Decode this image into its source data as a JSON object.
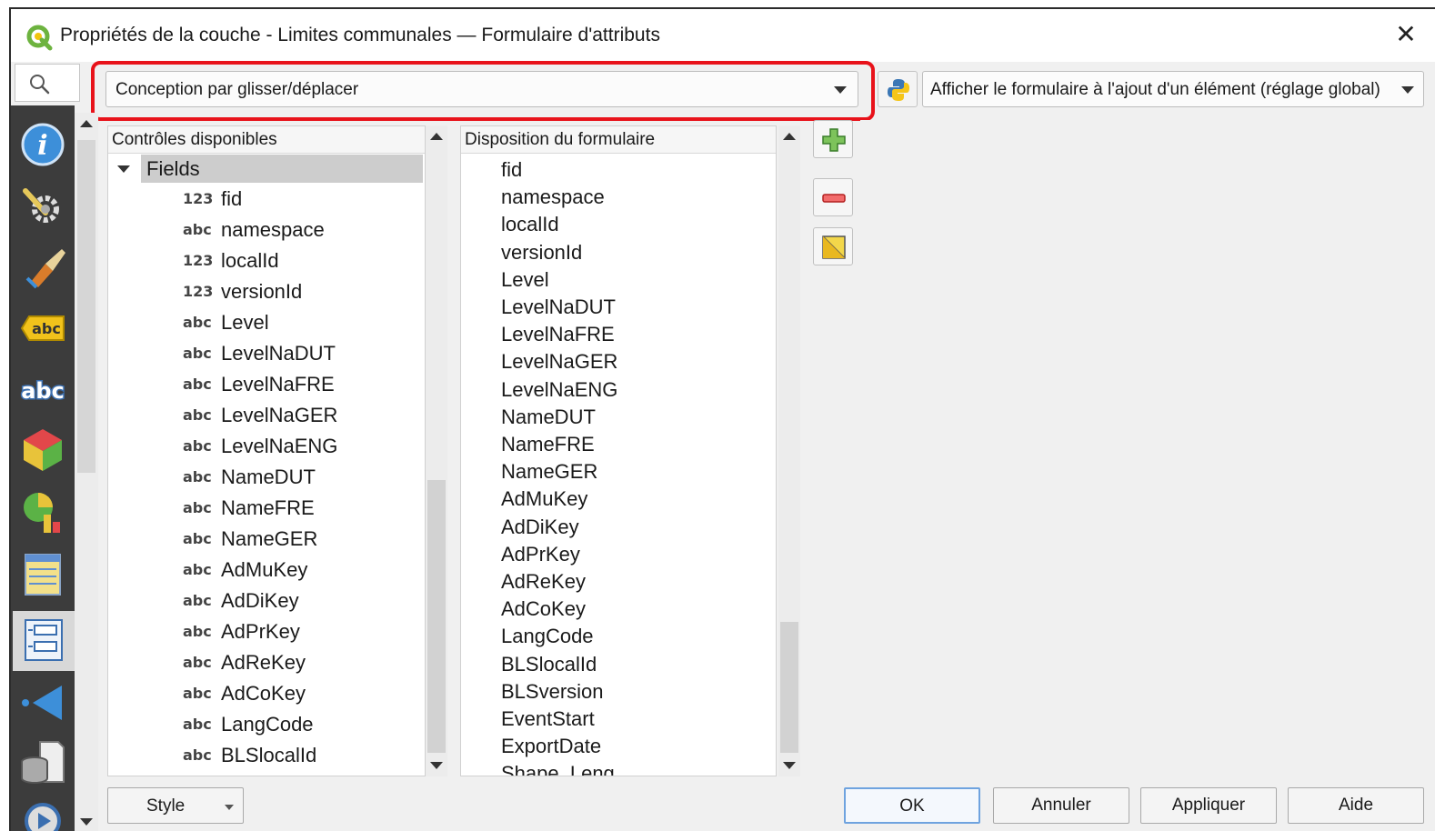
{
  "window": {
    "title": "Propriétés de la couche - Limites communales — Formulaire d'attributs",
    "close_glyph": "✕"
  },
  "top_controls": {
    "layout_mode": "Conception par glisser/déplacer",
    "display_form": "Afficher le formulaire à l'ajout d'un élément (réglage global)"
  },
  "available_controls": {
    "header": "Contrôles disponibles",
    "root": "Fields",
    "fields": [
      {
        "type": "123",
        "name": "fid"
      },
      {
        "type": "abc",
        "name": "namespace"
      },
      {
        "type": "123",
        "name": "localId"
      },
      {
        "type": "123",
        "name": "versionId"
      },
      {
        "type": "abc",
        "name": "Level"
      },
      {
        "type": "abc",
        "name": "LevelNaDUT"
      },
      {
        "type": "abc",
        "name": "LevelNaFRE"
      },
      {
        "type": "abc",
        "name": "LevelNaGER"
      },
      {
        "type": "abc",
        "name": "LevelNaENG"
      },
      {
        "type": "abc",
        "name": "NameDUT"
      },
      {
        "type": "abc",
        "name": "NameFRE"
      },
      {
        "type": "abc",
        "name": "NameGER"
      },
      {
        "type": "abc",
        "name": "AdMuKey"
      },
      {
        "type": "abc",
        "name": "AdDiKey"
      },
      {
        "type": "abc",
        "name": "AdPrKey"
      },
      {
        "type": "abc",
        "name": "AdReKey"
      },
      {
        "type": "abc",
        "name": "AdCoKey"
      },
      {
        "type": "abc",
        "name": "LangCode"
      },
      {
        "type": "abc",
        "name": "BLSlocalId"
      }
    ]
  },
  "form_layout": {
    "header": "Disposition du formulaire",
    "items": [
      "fid",
      "namespace",
      "localId",
      "versionId",
      "Level",
      "LevelNaDUT",
      "LevelNaFRE",
      "LevelNaGER",
      "LevelNaENG",
      "NameDUT",
      "NameFRE",
      "NameGER",
      "AdMuKey",
      "AdDiKey",
      "AdPrKey",
      "AdReKey",
      "AdCoKey",
      "LangCode",
      "BLSlocalId",
      "BLSversion",
      "EventStart",
      "ExportDate",
      "Shape_Leng"
    ]
  },
  "sidebar_icons": [
    "information-icon",
    "source-settings-icon",
    "symbology-icon",
    "labels-icon",
    "masks-icon",
    "3d-view-icon",
    "diagrams-icon",
    "fields-icon",
    "attributes-form-icon",
    "joins-icon",
    "auxiliary-storage-icon",
    "actions-icon"
  ],
  "buttons": {
    "style": "Style",
    "ok": "OK",
    "cancel": "Annuler",
    "apply": "Appliquer",
    "help": "Aide"
  },
  "colors": {
    "highlight": "#e8121a",
    "sidebar_bg": "#3c3c3c",
    "default_button_border": "#6fa3df"
  }
}
